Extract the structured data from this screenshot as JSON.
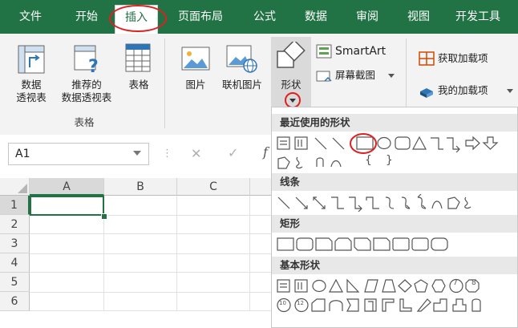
{
  "menu": {
    "tabs": [
      {
        "label": "文件"
      },
      {
        "label": "开始"
      },
      {
        "label": "插入"
      },
      {
        "label": "页面布局"
      },
      {
        "label": "公式"
      },
      {
        "label": "数据"
      },
      {
        "label": "审阅"
      },
      {
        "label": "视图"
      },
      {
        "label": "开发工具"
      }
    ],
    "active_index": 2
  },
  "ribbon": {
    "pivot_table": {
      "label_line1": "数据",
      "label_line2": "透视表"
    },
    "recommended_pivot": {
      "label_line1": "推荐的",
      "label_line2": "数据透视表"
    },
    "table": {
      "label": "表格"
    },
    "tables_group_label": "表格",
    "picture": {
      "label": "图片"
    },
    "online_picture": {
      "label": "联机图片"
    },
    "shapes": {
      "label": "形状"
    },
    "smartart": {
      "label": "SmartArt"
    },
    "screenshot": {
      "label": "屏幕截图"
    },
    "get_addins": {
      "label": "获取加载项"
    },
    "my_addins": {
      "label": "我的加载项"
    }
  },
  "formula_bar": {
    "name_box": "A1",
    "fx": "f"
  },
  "grid": {
    "columns": [
      "A",
      "B",
      "C"
    ],
    "rows": [
      "1",
      "2",
      "3",
      "4",
      "5",
      "6"
    ],
    "selected_cell": "A1"
  },
  "shapes_dropdown": {
    "sections": [
      {
        "title": "最近使用的形状"
      },
      {
        "title": "线条"
      },
      {
        "title": "矩形"
      },
      {
        "title": "基本形状"
      }
    ],
    "brace_chars": [
      "{",
      "}"
    ],
    "octagon_number": "8",
    "circle_numbers": [
      "10",
      "12"
    ]
  },
  "colors": {
    "brand_green": "#217346",
    "highlight_red": "#e02020",
    "shape_stroke": "#555555",
    "selected_cell_border": "#217346"
  }
}
